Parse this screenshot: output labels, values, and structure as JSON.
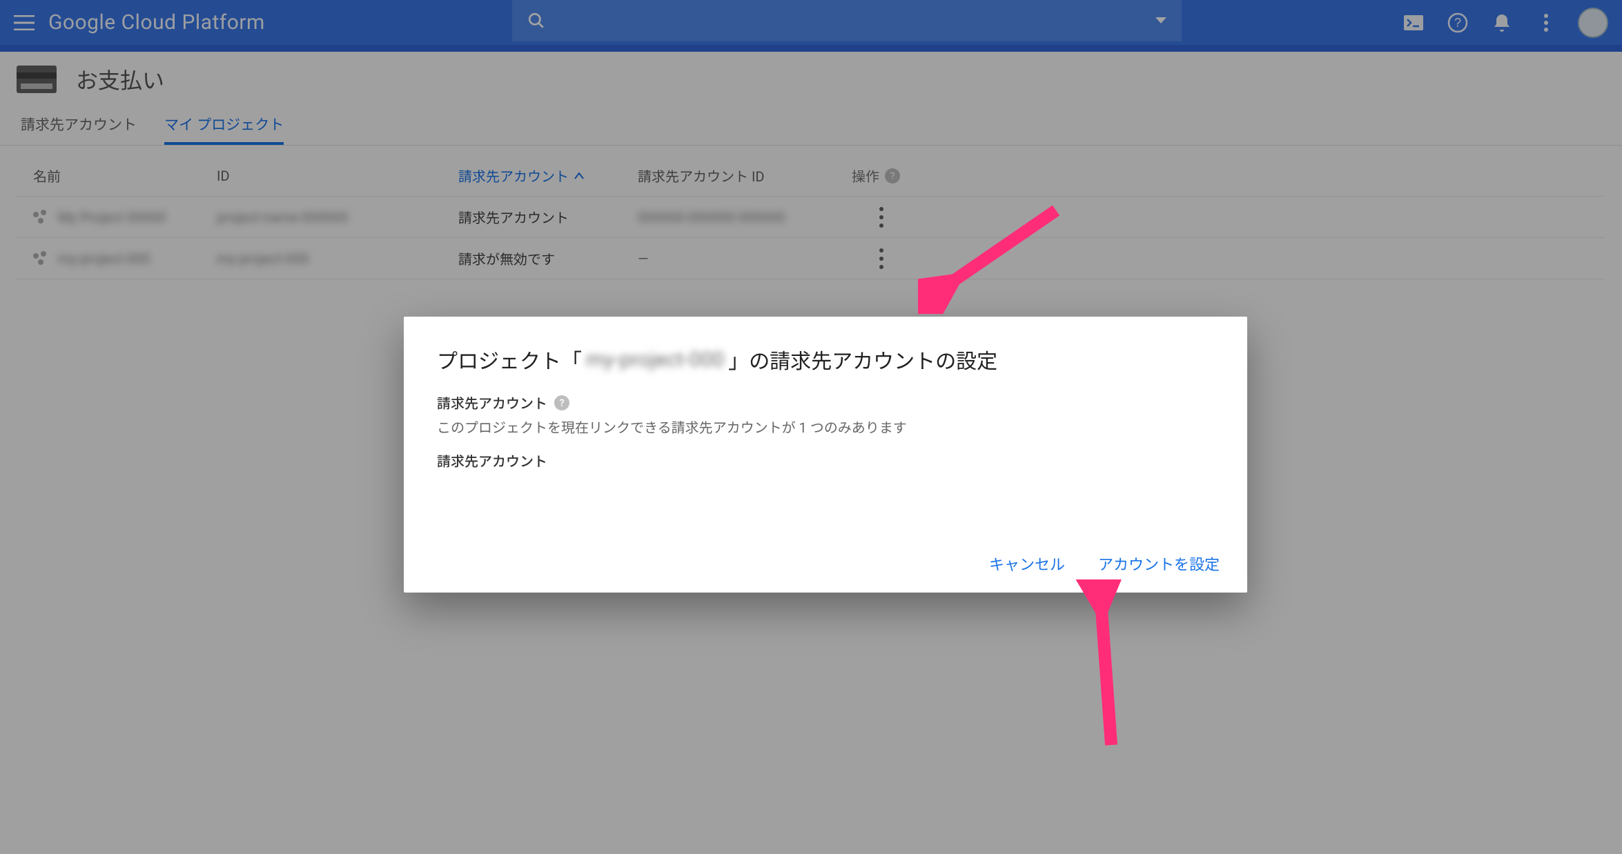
{
  "header": {
    "brand": "Google Cloud Platform"
  },
  "search": {
    "placeholder": ""
  },
  "page": {
    "title": "お支払い"
  },
  "tabs": {
    "billing_accounts": "請求先アカウント",
    "my_projects": "マイ プロジェクト"
  },
  "columns": {
    "name": "名前",
    "id": "ID",
    "billing_account": "請求先アカウント",
    "billing_account_id": "請求先アカウント ID",
    "actions": "操作"
  },
  "rows": [
    {
      "name": "My Project 00000",
      "id": "project-name-000000",
      "ba": "請求先アカウント",
      "bid": "000000-000000-000000"
    },
    {
      "name": "my-project-000",
      "id": "my-project-000",
      "ba": "請求が無効です",
      "bid": "—"
    }
  ],
  "modal": {
    "title_prefix": "プロジェクト「",
    "project_name": "my-project-000",
    "title_suffix": "」の請求先アカウントの設定",
    "field_label": "請求先アカウント",
    "sub": "このプロジェクトを現在リンクできる請求先アカウントが 1 つのみあります",
    "value": "請求先アカウント",
    "cancel": "キャンセル",
    "confirm": "アカウントを設定"
  }
}
